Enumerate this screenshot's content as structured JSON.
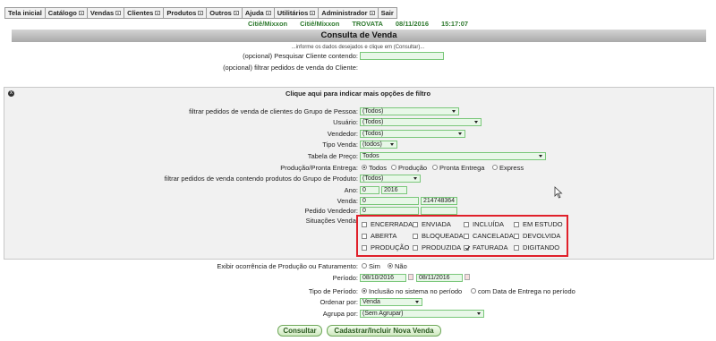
{
  "menu": [
    {
      "label": "Tela inicial",
      "dropdown": false
    },
    {
      "label": "Catálogo",
      "dropdown": true
    },
    {
      "label": "Vendas",
      "dropdown": true
    },
    {
      "label": "Clientes",
      "dropdown": true
    },
    {
      "label": "Produtos",
      "dropdown": true
    },
    {
      "label": "Outros",
      "dropdown": true
    },
    {
      "label": "Ajuda",
      "dropdown": true
    },
    {
      "label": "Utilitários",
      "dropdown": true
    },
    {
      "label": "Administrador",
      "dropdown": true
    },
    {
      "label": "Sair",
      "dropdown": false
    }
  ],
  "info": {
    "company1": "Citiê/Mixxon",
    "company2": "Citiê/Mixxon",
    "user": "TROVATA",
    "date": "08/11/2016",
    "time": "15:17:07"
  },
  "page_title": "Consulta de Venda",
  "instruction": "...informe os dados desejados e clique em (Consultar)...",
  "top_fields": {
    "search_client_label": "(opcional) Pesquisar Cliente contendo:",
    "search_client_value": "",
    "filter_client_label": "(opcional) filtrar pedidos de venda do Cliente:"
  },
  "panel": {
    "toggle_symbol": "x",
    "heading": "Clique aqui para indicar mais opções de filtro",
    "grupo_pessoa_label": "filtrar pedidos de venda de clientes do Grupo de Pessoa:",
    "grupo_pessoa_value": "(Todos)",
    "usuario_label": "Usuário:",
    "usuario_value": "(Todos)",
    "vendedor_label": "Vendedor:",
    "vendedor_value": "(Todos)",
    "tipo_venda_label": "Tipo Venda:",
    "tipo_venda_value": "(todos)",
    "tabela_preco_label": "Tabela de Preço:",
    "tabela_preco_value": "Todos",
    "producao_label": "Produção/Pronta Entrega:",
    "producao_options": [
      {
        "label": "Todos",
        "selected": true
      },
      {
        "label": "Produção",
        "selected": false
      },
      {
        "label": "Pronta Entrega",
        "selected": false
      },
      {
        "label": "Express",
        "selected": false
      }
    ],
    "grupo_produto_label": "filtrar pedidos de venda contendo produtos do Grupo de Produto:",
    "grupo_produto_value": "(Todos)",
    "ano_label": "Ano:",
    "ano_from": "0",
    "ano_to": "2016",
    "venda_label": "Venda:",
    "venda_from": "0",
    "venda_to": "2147483647",
    "pedido_vendedor_label": "Pedido Vendedor:",
    "pedido_vendedor_from": "0",
    "pedido_vendedor_to": "",
    "situacoes_label": "Situações Venda:",
    "situacoes": [
      {
        "label": "ENCERRADA",
        "checked": false
      },
      {
        "label": "ENVIADA",
        "checked": false
      },
      {
        "label": "INCLUÍDA",
        "checked": false
      },
      {
        "label": "EM ESTUDO",
        "checked": false
      },
      {
        "label": "ABERTA",
        "checked": false
      },
      {
        "label": "BLOQUEADA",
        "checked": false
      },
      {
        "label": "CANCELADA",
        "checked": false
      },
      {
        "label": "DEVOLVIDA",
        "checked": false
      },
      {
        "label": "PRODUÇÃO",
        "checked": false
      },
      {
        "label": "PRODUZIDA",
        "checked": false
      },
      {
        "label": "FATURADA",
        "checked": true
      },
      {
        "label": "DIGITANDO",
        "checked": false
      }
    ]
  },
  "bottom": {
    "exibir_label": "Exibir ocorrência de Produção ou Faturamento:",
    "exibir_options": [
      {
        "label": "Sim",
        "selected": false
      },
      {
        "label": "Não",
        "selected": true
      }
    ],
    "periodo_label": "Período:",
    "periodo_from": "08/10/2016",
    "periodo_to": "08/11/2016",
    "tipo_periodo_label": "Tipo de Período:",
    "tipo_periodo_options": [
      {
        "label": "Inclusão no sistema no período",
        "selected": true
      },
      {
        "label": "com Data de Entrega no período",
        "selected": false
      }
    ],
    "ordenar_label": "Ordenar por:",
    "ordenar_value": "Venda",
    "agrupa_label": "Agrupa por:",
    "agrupa_value": "(Sem Agrupar)"
  },
  "buttons": {
    "consultar": "Consultar",
    "cadastrar": "Cadastrar/Incluir Nova Venda"
  },
  "colors": {
    "accent_green": "#2f7a2f",
    "field_bg": "#e8f7e8",
    "field_border": "#7ac77a",
    "highlight_red": "#e0202a"
  }
}
